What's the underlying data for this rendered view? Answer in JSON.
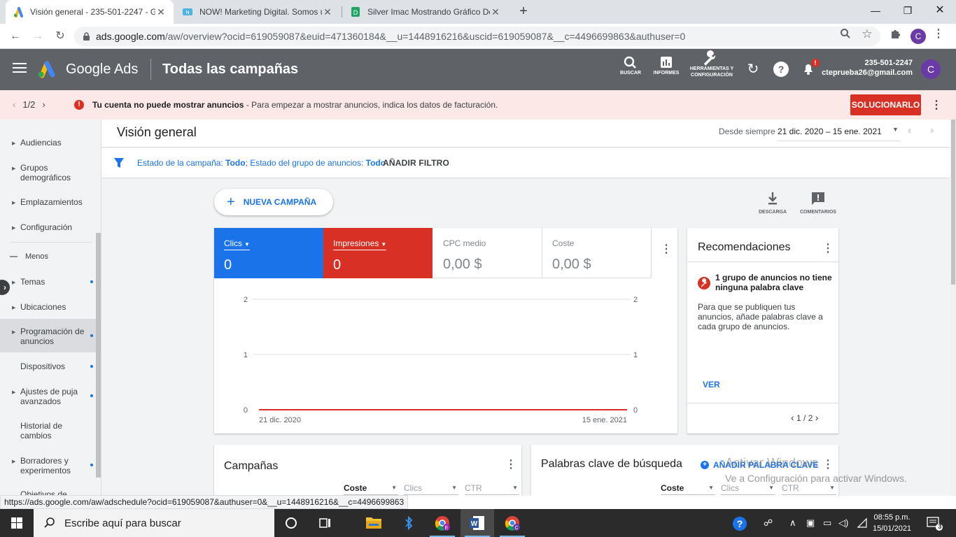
{
  "browser": {
    "tabs": [
      {
        "title": "Visión general - 235-501-2247 - G",
        "active": true
      },
      {
        "title": "NOW! Marketing Digital. Somos u",
        "active": false
      },
      {
        "title": "Silver Imac Mostrando Gráfico De",
        "active": false
      }
    ],
    "new_tab": "+",
    "url_host": "ads.google.com",
    "url_path": "/aw/overview?ocid=619059087&euid=471360184&__u=1448916216&uscid=619059087&__c=4496699863&authuser=0",
    "profile_initial": "C"
  },
  "ads_header": {
    "brand": "Google Ads",
    "page_title": "Todas las campañas",
    "tools": [
      {
        "label": "BUSCAR"
      },
      {
        "label": "INFORMES"
      },
      {
        "label": "HERRAMIENTAS Y CONFIGURACIÓN"
      }
    ],
    "notification_badge": "!",
    "account_id": "235-501-2247",
    "account_email": "cteprueba26@gmail.com",
    "avatar_initial": "C"
  },
  "alert": {
    "pager": "1/2",
    "title": "Tu cuenta no puede mostrar anuncios",
    "message": " - Para empezar a mostrar anuncios, indica los datos de facturación.",
    "action": "SOLUCIONARLO"
  },
  "sidebar": {
    "items": [
      {
        "label": "Audiencias",
        "arrow": true
      },
      {
        "label": "Grupos demográficos",
        "arrow": true
      },
      {
        "label": "Emplazamientos",
        "arrow": true
      },
      {
        "label": "Configuración",
        "arrow": true
      },
      {
        "label": "Menos"
      },
      {
        "label": "Temas",
        "arrow": true,
        "dot": true
      },
      {
        "label": "Ubicaciones",
        "arrow": true
      },
      {
        "label": "Programación de anuncios",
        "arrow": true,
        "dot": true,
        "selected": true
      },
      {
        "label": "Dispositivos",
        "dot": true
      },
      {
        "label": "Ajustes de puja avanzados",
        "arrow": true,
        "dot": true
      },
      {
        "label": "Historial de cambios"
      },
      {
        "label": "Borradores y experimentos",
        "arrow": true,
        "dot": true
      },
      {
        "label": "Objetivos de"
      }
    ]
  },
  "overview": {
    "title": "Visión general",
    "range_label": "Desde siempre",
    "range_value": "21 dic. 2020 – 15 ene. 2021",
    "filter_text_1": "Estado de la campaña: ",
    "filter_value_1": "Todo",
    "filter_text_2": "; Estado del grupo de anuncios: ",
    "filter_value_2": "Todo",
    "add_filter": "AÑADIR FILTRO",
    "new_campaign": "NUEVA CAMPAÑA",
    "download": "DESCARGA",
    "comments": "COMENTARIOS"
  },
  "metrics": [
    {
      "name": "Clics",
      "value": "0",
      "color": "#1a73e8"
    },
    {
      "name": "Impresiones",
      "value": "0",
      "color": "#d93025"
    },
    {
      "name": "CPC medio",
      "value": "0,00 $"
    },
    {
      "name": "Coste",
      "value": "0,00 $"
    }
  ],
  "chart_data": {
    "type": "line",
    "x": [
      "21 dic. 2020",
      "15 ene. 2021"
    ],
    "x_tick_labels": [
      "21 dic. 2020",
      "15 ene. 2021"
    ],
    "y_ticks_left": [
      "2",
      "1",
      "0"
    ],
    "y_ticks_right": [
      "2",
      "1",
      "0"
    ],
    "ylim": [
      0,
      2
    ],
    "series": [
      {
        "name": "Clics",
        "values": [
          0,
          0
        ],
        "color": "#1a73e8"
      },
      {
        "name": "Impresiones",
        "values": [
          0,
          0
        ],
        "color": "#d93025"
      }
    ],
    "grid": true
  },
  "recommendations": {
    "title": "Recomendaciones",
    "heading": "1 grupo de anuncios no tiene ninguna palabra clave",
    "body": "Para que se publiquen tus anuncios, añade palabras clave a cada grupo de anuncios.",
    "view": "VER",
    "pager": "1 / 2"
  },
  "campaigns_card": {
    "title": "Campañas",
    "columns": [
      "Coste",
      "Clics",
      "CTR"
    ]
  },
  "keywords_card": {
    "title": "Palabras clave de búsqueda",
    "add": "AÑADIR PALABRA CLAVE",
    "columns": [
      "Coste",
      "Clics",
      "CTR"
    ]
  },
  "windows_watermark": {
    "line1": "Activar Windows",
    "line2": "Ve a Configuración para activar Windows."
  },
  "status_url": "https://ads.google.com/aw/adschedule?ocid=619059087&authuser=0&__u=1448916216&__c=4496699863",
  "taskbar": {
    "search_placeholder": "Escribe aquí para buscar",
    "time": "08:55 p.m.",
    "date": "15/01/2021",
    "notifications": "3"
  }
}
